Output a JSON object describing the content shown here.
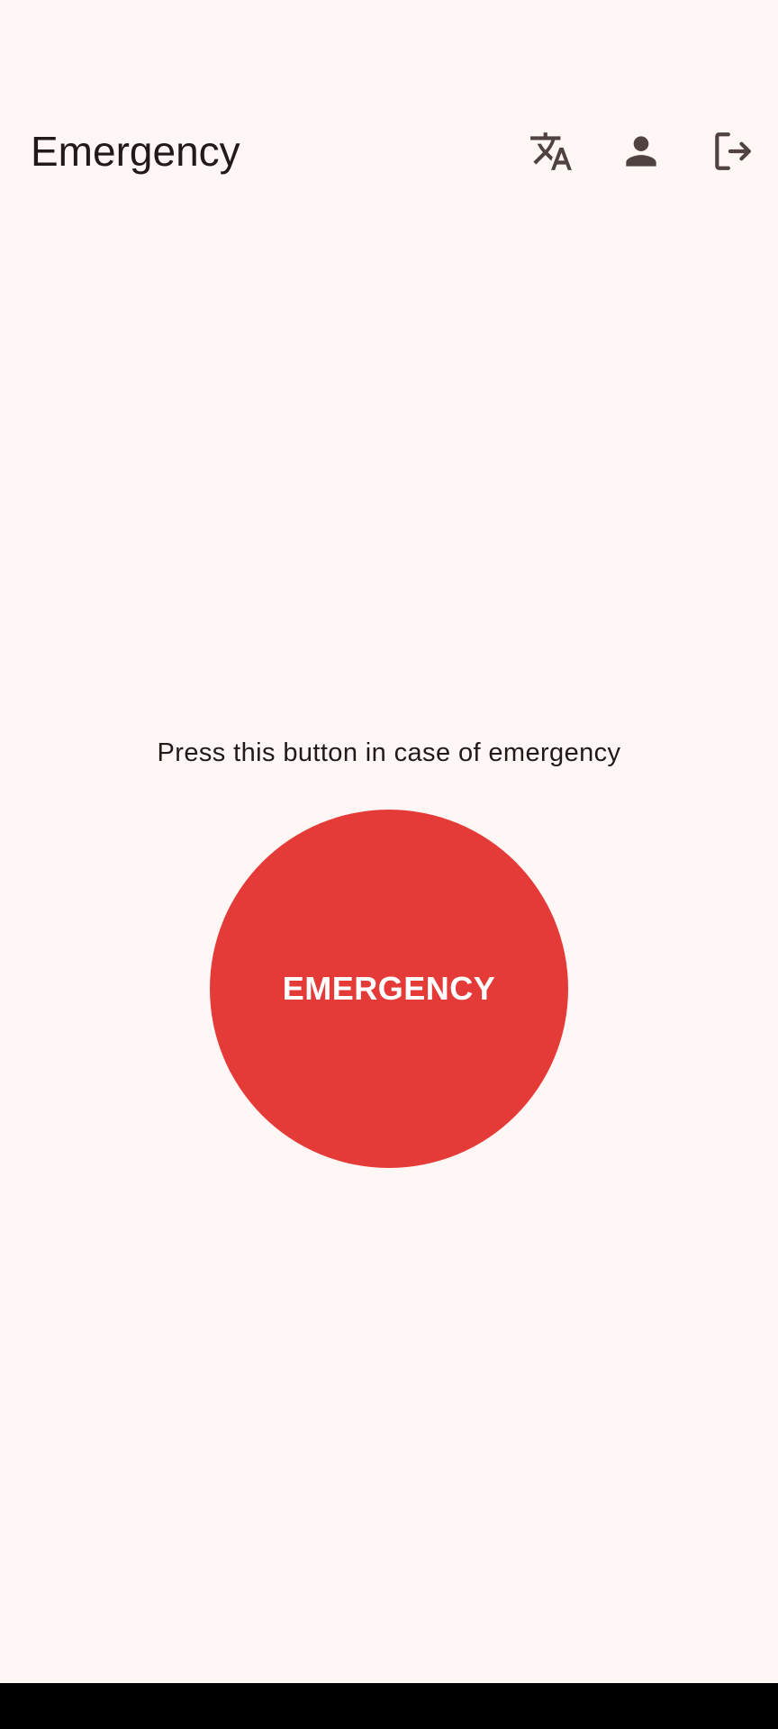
{
  "app_bar": {
    "title": "Emergency",
    "actions": [
      {
        "name": "translate",
        "icon": "translate-icon"
      },
      {
        "name": "profile",
        "icon": "person-icon"
      },
      {
        "name": "logout",
        "icon": "logout-icon"
      }
    ]
  },
  "main": {
    "prompt": "Press this button in case of emergency",
    "emergency_button_label": "EMERGENCY"
  },
  "colors": {
    "background": "#fff7f5",
    "emergency_red": "#e53b38",
    "icon": "#4f4240",
    "text": "#221a19",
    "nav_bar": "#000000"
  }
}
